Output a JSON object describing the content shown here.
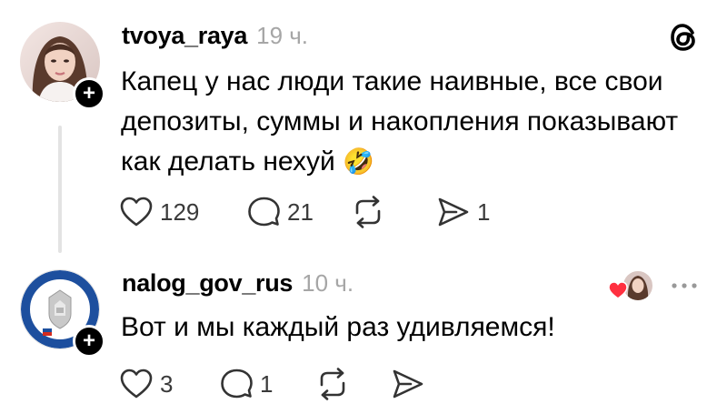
{
  "post": {
    "username": "tvoya_raya",
    "time": "19 ч.",
    "text": "Капец у нас люди такие наивные, все свои депозиты, суммы и накопления показывают как делать нехуй",
    "emoji": "🤣",
    "likes": "129",
    "comments": "21",
    "reposts": "",
    "shares": "1",
    "follow_icon": "plus-icon",
    "brand_icon": "threads-logo-icon"
  },
  "reply": {
    "username": "nalog_gov_rus",
    "time": "10 ч.",
    "text": "Вот и мы каждый раз удивляемся!",
    "likes": "3",
    "comments": "1",
    "more_icon": "more-dots-icon",
    "liked_by_icon": "liked-by-author-icon"
  },
  "colors": {
    "text": "#000000",
    "muted": "#a6a6a6",
    "heart": "#ff3040",
    "line": "#e3e3e3"
  }
}
